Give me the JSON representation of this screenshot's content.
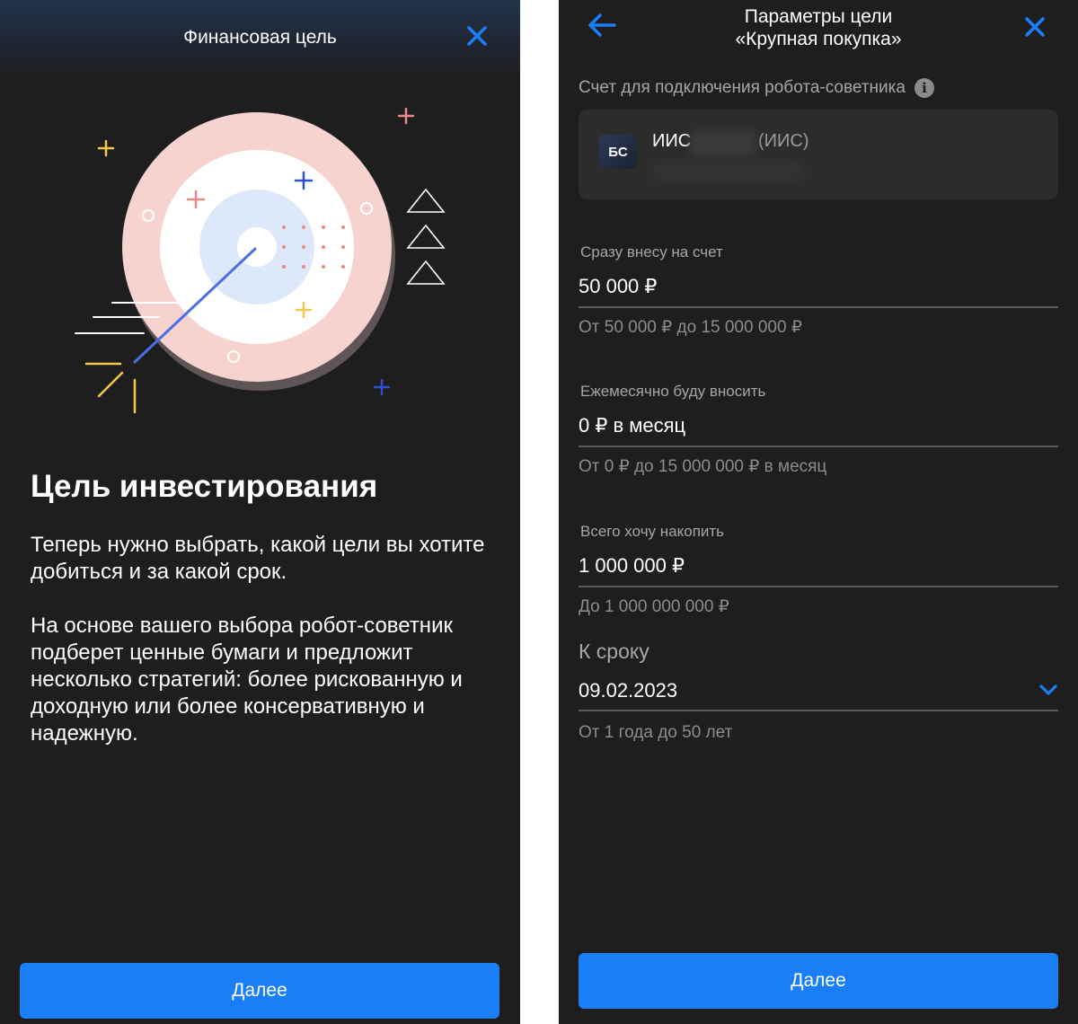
{
  "left": {
    "header_title": "Финансовая цель",
    "heading": "Цель инвестирования",
    "paragraph_1": "Теперь нужно выбрать, какой цели вы хотите добиться и за какой срок.",
    "paragraph_2": "На основе вашего выбора робот-советник подберет ценные бумаги и предложит несколько стратегий: более рискованную и доходную или более консервативную и надежную.",
    "next_label": "Далее"
  },
  "right": {
    "title_line1": "Параметры цели",
    "title_line2": "«Крупная покупка»",
    "account_label": "Счет для подключения робота-советника",
    "account": {
      "badge": "БС",
      "name": "ИИС",
      "type": "(ИИС)"
    },
    "fields": {
      "initial": {
        "label": "Сразу внесу на счет",
        "value": "50 000 ₽",
        "hint": "От 50 000 ₽ до 15 000 000 ₽"
      },
      "monthly": {
        "label": "Ежемесячно буду вносить",
        "value": "0 ₽ в месяц",
        "hint": "От 0 ₽ до 15 000 000 ₽ в месяц"
      },
      "target": {
        "label": "Всего хочу накопить",
        "value": "1 000 000 ₽",
        "hint": "До 1 000 000 000 ₽"
      }
    },
    "term": {
      "label": "К сроку",
      "value": "09.02.2023",
      "hint": "От 1 года до 50 лет"
    },
    "next_label": "Далее"
  },
  "icons": {
    "close": "close-icon",
    "back": "arrow-left-icon",
    "info": "info-icon",
    "dropdown": "chevron-down-icon",
    "illustration": "target-illustration"
  },
  "colors": {
    "accent": "#1a7ff7",
    "background": "#1e1e1f",
    "card": "#2c2c2d",
    "muted_text": "#a6a6a6",
    "target_pink": "#f7d3d0",
    "target_blue": "#dde8fb"
  }
}
